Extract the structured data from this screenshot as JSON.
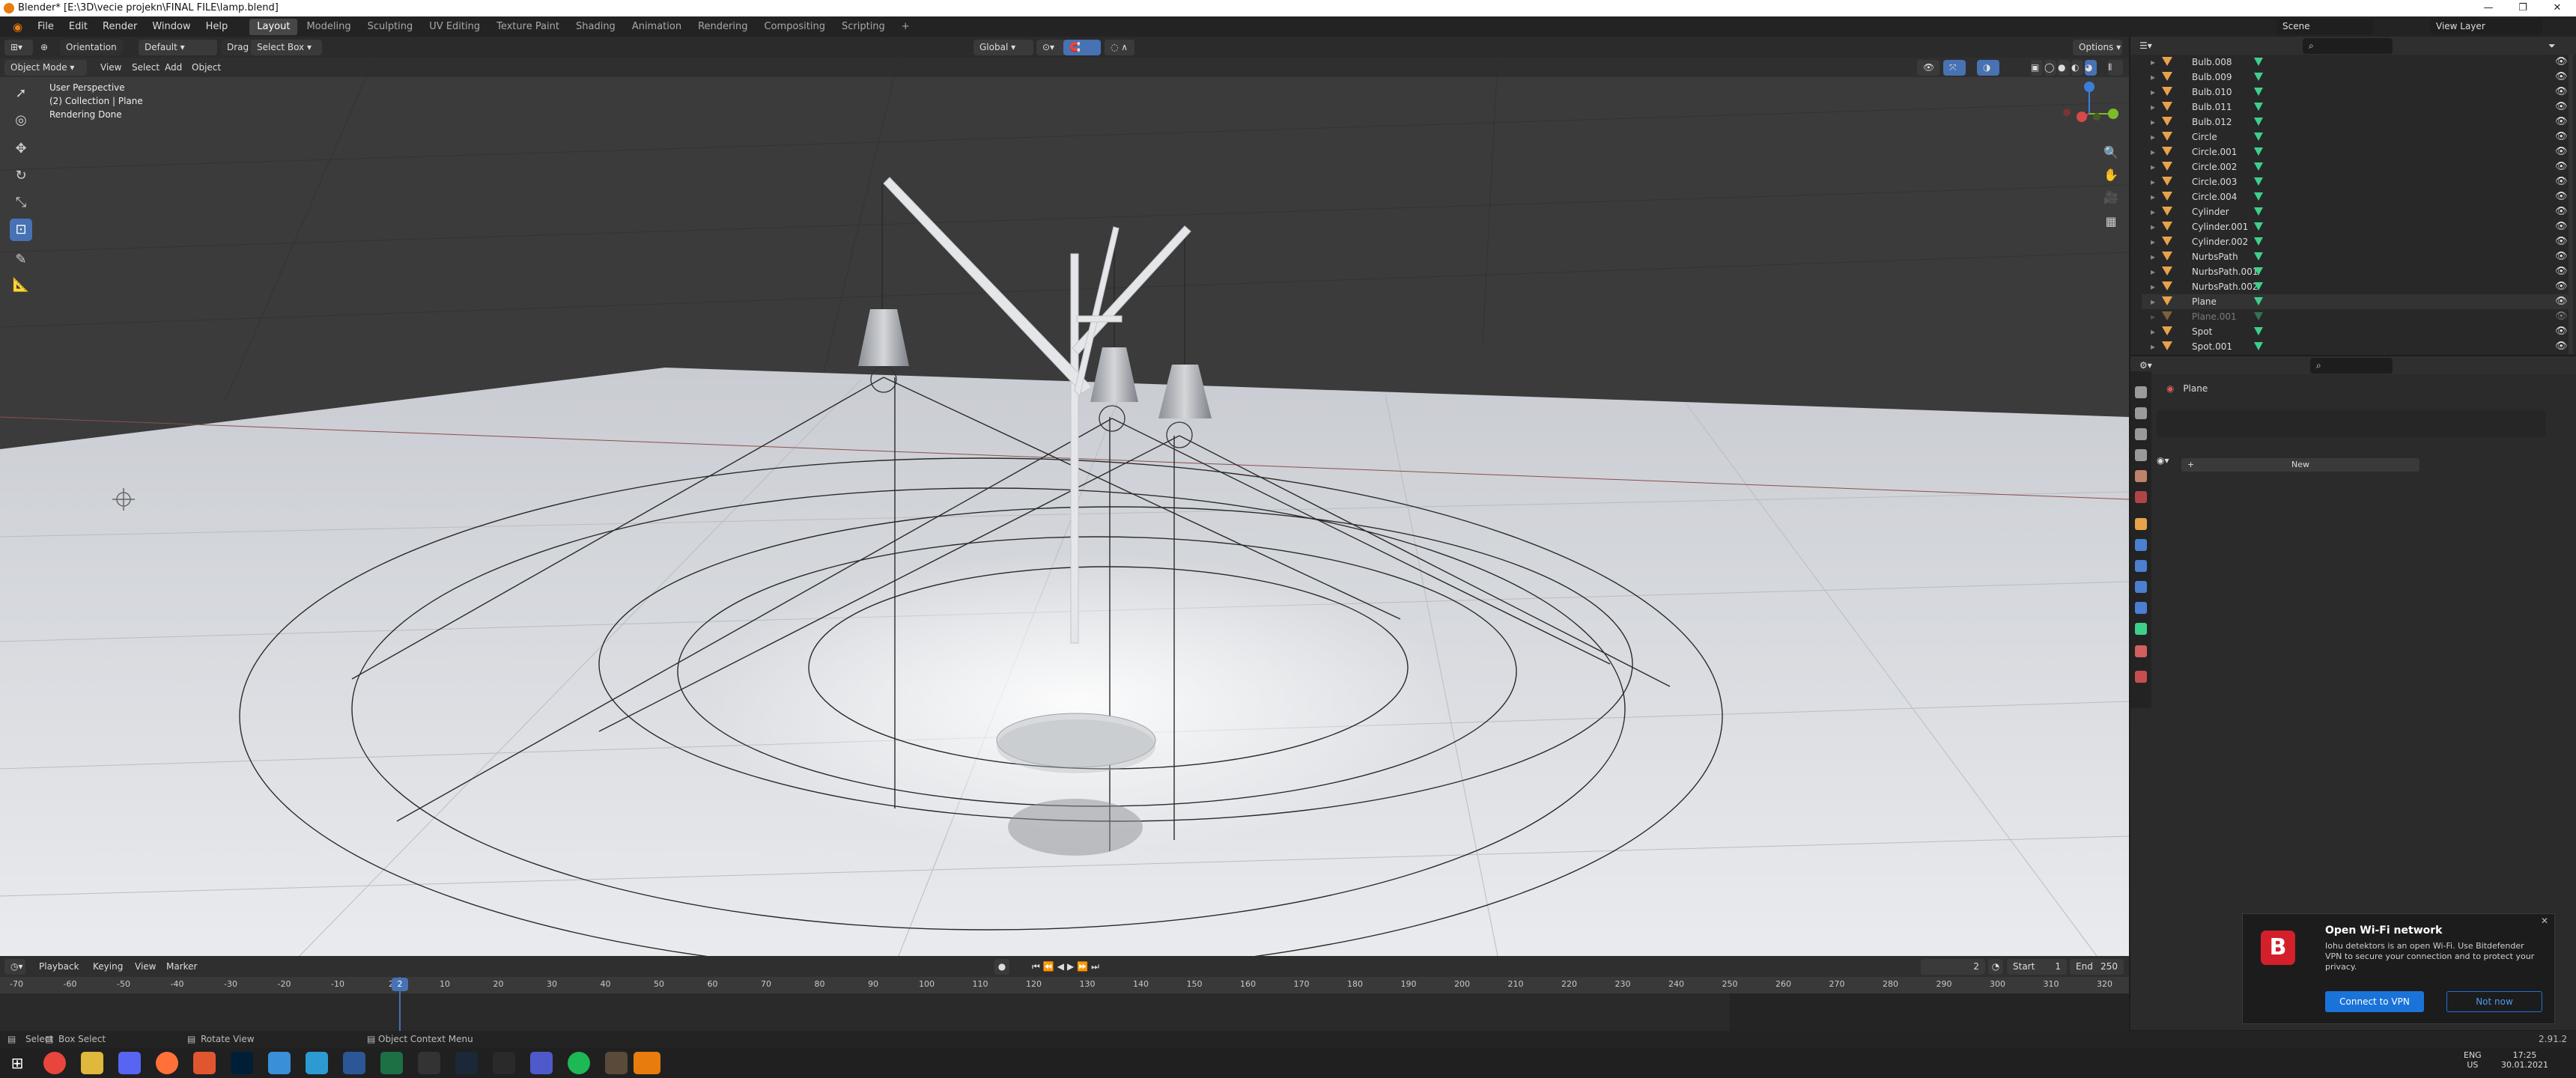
{
  "window": {
    "title": "Blender* [E:\\3D\\vecie projekn\\FINAL FILE\\lamp.blend]"
  },
  "topbar": {
    "menus": [
      "File",
      "Edit",
      "Render",
      "Window",
      "Help"
    ],
    "workspaces": [
      "Layout",
      "Modeling",
      "Sculpting",
      "UV Editing",
      "Texture Paint",
      "Shading",
      "Animation",
      "Rendering",
      "Compositing",
      "Scripting"
    ],
    "active_workspace": "Layout",
    "scene": "Scene",
    "view_layer": "View Layer",
    "add": "+"
  },
  "viewport_header": {
    "orientation_label": "Orientation",
    "orientation_value": "Default",
    "drag_label": "Drag",
    "drag_value": "Select Box",
    "transform_orientation": "Global",
    "options": "Options",
    "mode": "Object Mode",
    "menus": [
      "View",
      "Select",
      "Add",
      "Object"
    ]
  },
  "viewport_info": {
    "line1": "User Perspective",
    "line2": "(2) Collection | Plane",
    "line3": "Rendering Done"
  },
  "timeline": {
    "menus": [
      "Playback",
      "Keying",
      "View",
      "Marker"
    ],
    "current_frame": "2",
    "start_label": "Start",
    "start_value": "1",
    "end_label": "End",
    "end_value": "250",
    "ruler": [
      "-70",
      "-60",
      "-50",
      "-40",
      "-30",
      "-20",
      "-10",
      "2",
      "10",
      "20",
      "30",
      "40",
      "50",
      "60",
      "70",
      "80",
      "90",
      "100",
      "110",
      "120",
      "130",
      "140",
      "150",
      "160",
      "170",
      "180",
      "190",
      "200",
      "210",
      "220",
      "230",
      "240",
      "250",
      "260",
      "270",
      "280",
      "290",
      "300",
      "310",
      "320"
    ]
  },
  "statusbar": {
    "select": "Select",
    "box_select": "Box Select",
    "rotate_view": "Rotate View",
    "context_menu": "Object Context Menu",
    "version": "2.91.2"
  },
  "outliner": {
    "items": [
      "Bulb.008",
      "Bulb.009",
      "Bulb.010",
      "Bulb.011",
      "Bulb.012",
      "Circle",
      "Circle.001",
      "Circle.002",
      "Circle.003",
      "Circle.004",
      "Cylinder",
      "Cylinder.001",
      "Cylinder.002",
      "NurbsPath",
      "NurbsPath.001",
      "NurbsPath.002",
      "Plane",
      "Plane.001",
      "Spot",
      "Spot.001"
    ]
  },
  "properties": {
    "object_name": "Plane",
    "new_button": "New"
  },
  "notification": {
    "title": "Open Wi-Fi network",
    "body": "Iohu detektors is an open Wi-Fi. Use Bitdefender VPN to secure your connection and to protect your privacy.",
    "primary": "Connect to VPN",
    "secondary": "Not now"
  },
  "taskbar": {
    "lang1": "ENG",
    "lang2": "US",
    "time": "17:25",
    "date": "30.01.2021"
  },
  "colors": {
    "accent": "#4772b3",
    "blender_orange": "#e87d0d",
    "outliner_green": "#3ed08a"
  }
}
